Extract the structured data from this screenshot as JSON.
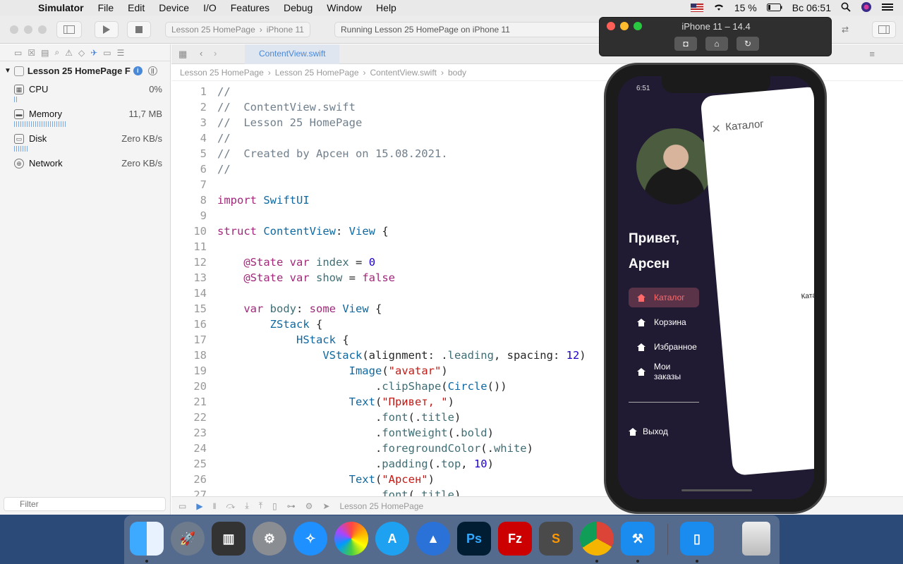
{
  "menubar": {
    "app_name": "Simulator",
    "items": [
      "File",
      "Edit",
      "Device",
      "I/O",
      "Features",
      "Debug",
      "Window",
      "Help"
    ],
    "battery": "15 %",
    "clock": "Вс 06:51"
  },
  "toolbar": {
    "scheme_project": "Lesson 25 HomePage",
    "scheme_device": "iPhone 11",
    "activity": "Running Lesson 25 HomePage on iPhone 11"
  },
  "navigator": {
    "project": "Lesson 25 HomePage F",
    "gauges": [
      {
        "label": "CPU",
        "value": "0%",
        "fill": 0.02
      },
      {
        "label": "Memory",
        "value": "11,7 MB",
        "fill": 0.35
      },
      {
        "label": "Disk",
        "value": "Zero KB/s",
        "fill": 0.1
      },
      {
        "label": "Network",
        "value": "Zero KB/s",
        "fill": 0
      }
    ],
    "filter_placeholder": "Filter"
  },
  "editor": {
    "tab": "ContentView.swift",
    "breadcrumb": [
      "Lesson 25 HomePage",
      "Lesson 25 HomePage",
      "ContentView.swift",
      "body"
    ],
    "lines": [
      "//",
      "//  ContentView.swift",
      "//  Lesson 25 HomePage",
      "//",
      "//  Created by Арсен on 15.08.2021.",
      "//",
      "",
      "import SwiftUI",
      "",
      "struct ContentView: View {",
      "",
      "    @State var index = 0",
      "    @State var show = false",
      "",
      "    var body: some View {",
      "        ZStack {",
      "            HStack {",
      "                VStack(alignment: .leading, spacing: 12)",
      "                    Image(\"avatar\")",
      "                        .clipShape(Circle())",
      "                    Text(\"Привет, \")",
      "                        .font(.title)",
      "                        .fontWeight(.bold)",
      "                        .foregroundColor(.white)",
      "                        .padding(.top, 10)",
      "                    Text(\"Арсен\")",
      "                        .font(.title)"
    ],
    "debug_target": "Lesson 25 HomePage"
  },
  "simulator": {
    "title": "iPhone 11 – 14.4",
    "time": "6:51",
    "greeting_1": "Привет,",
    "greeting_2": "Арсен",
    "menu": [
      "Каталог",
      "Корзина",
      "Избранное",
      "Мои заказы"
    ],
    "logout": "Выход",
    "card_title": "Каталог",
    "card_label": "Каталог"
  },
  "dock": {
    "apps": [
      "Finder",
      "Launchpad",
      "Activity Monitor",
      "System Preferences",
      "Safari",
      "Photos",
      "App Store",
      "Instruments",
      "Photoshop",
      "FileZilla",
      "Sublime Text",
      "Chrome",
      "Xcode",
      "Simulator",
      "Trash"
    ]
  },
  "colors": {
    "accent": "#4a88d8",
    "menu_active_bg": "#5a3348",
    "menu_active_fg": "#ff6b6b",
    "drawer_bg": "#211a33"
  }
}
